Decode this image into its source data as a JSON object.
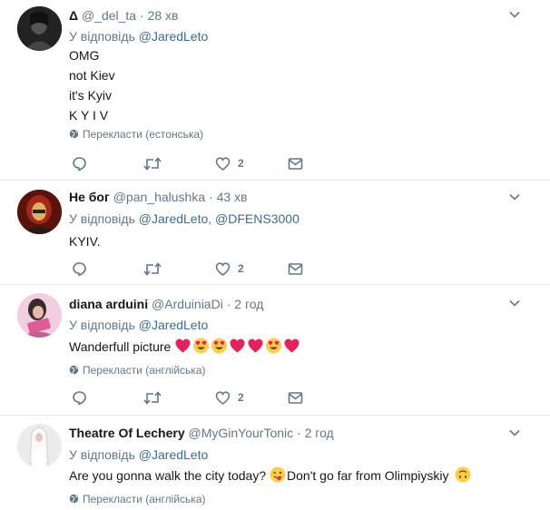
{
  "tweets": [
    {
      "name": "Δ",
      "handle": "@_del_ta",
      "time": "28 хв",
      "reply_prefix": "У відповідь",
      "reply_to": "@JaredLeto",
      "reply_extra": "",
      "lines": [
        "OMG",
        "not Kiev",
        "it's Kyiv",
        "K Y I V"
      ],
      "translate": "Перекласти (естонська)",
      "likes": "2",
      "avatar": "dark-portrait"
    },
    {
      "name": "Не бог",
      "handle": "@pan_halushka",
      "time": "43 хв",
      "reply_prefix": "У відповідь",
      "reply_to": "@JaredLeto",
      "reply_sep": ",",
      "reply_extra": "@DFENS3000",
      "lines": [
        "KYIV."
      ],
      "translate": "",
      "likes": "2",
      "avatar": "red-portrait"
    },
    {
      "name": "diana arduini",
      "handle": "@ArduiniaDi",
      "time": "2 год",
      "reply_prefix": "У відповідь",
      "reply_to": "@JaredLeto",
      "reply_extra": "",
      "lines": [
        "Wanderfull picture"
      ],
      "emojis": [
        "heart",
        "heart-eyes",
        "heart-eyes",
        "heart",
        "heart",
        "heart-eyes",
        "heart"
      ],
      "translate": "Перекласти (англійська)",
      "likes": "2",
      "avatar": "pink-portrait"
    },
    {
      "name": "Theatre Of Lechery",
      "handle": "@MyGinYourTonic",
      "time": "2 год",
      "reply_prefix": "У відповідь",
      "reply_to": "@JaredLeto",
      "reply_extra": "",
      "text_a": "Are you gonna walk the city today?",
      "text_b": "Don't go far from Olimpiyskiy",
      "translate": "Перекласти (англійська)",
      "likes": "",
      "avatar": "white-figure"
    }
  ],
  "icons": {
    "reply": "reply-icon",
    "retweet": "retweet-icon",
    "like": "heart-icon",
    "dm": "envelope-icon",
    "more": "chevron-down-icon",
    "translate": "globe-icon"
  },
  "colors": {
    "text": "#14171a",
    "muted": "#657786",
    "link": "#1b95e0",
    "heart": "#e0245e",
    "border": "#e6ecf0"
  }
}
